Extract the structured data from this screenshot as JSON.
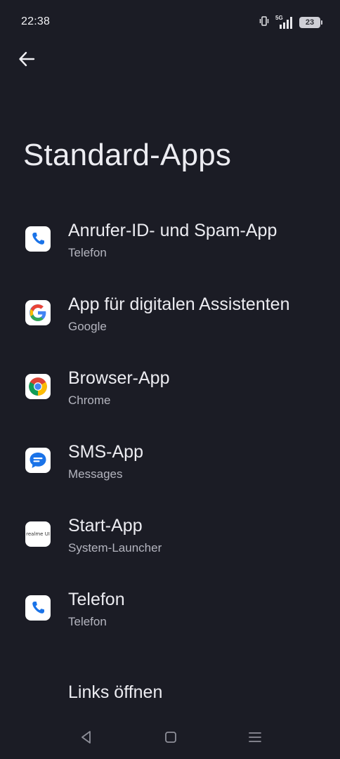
{
  "status_bar": {
    "time": "22:38",
    "network": "5G",
    "battery_level": "23",
    "icons": [
      "vibrate-icon",
      "signal-5g-icon",
      "battery-icon"
    ]
  },
  "header": {
    "back_icon": "back-arrow-icon",
    "title": "Standard-Apps"
  },
  "items": [
    {
      "title": "Anrufer-ID- und Spam-App",
      "subtitle": "Telefon",
      "icon": "phone-app-icon"
    },
    {
      "title": "App für digitalen Assistenten",
      "subtitle": "Google",
      "icon": "google-icon"
    },
    {
      "title": "Browser-App",
      "subtitle": "Chrome",
      "icon": "chrome-icon"
    },
    {
      "title": "SMS-App",
      "subtitle": "Messages",
      "icon": "messages-icon"
    },
    {
      "title": "Start-App",
      "subtitle": "System-Launcher",
      "icon": "realme-ui-icon",
      "icon_text": "realme UI"
    },
    {
      "title": "Telefon",
      "subtitle": "Telefon",
      "icon": "phone-app-icon"
    },
    {
      "title": "Links öffnen"
    }
  ],
  "nav_bar": {
    "icons": [
      "nav-back-icon",
      "nav-home-icon",
      "nav-recents-icon"
    ]
  },
  "colors": {
    "background": "#1b1c25",
    "text_primary": "#ececf1",
    "text_secondary": "#b4b5bf",
    "phone_blue": "#1a73e8"
  }
}
